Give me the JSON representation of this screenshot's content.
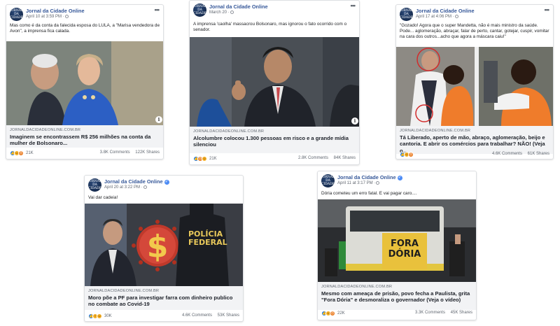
{
  "posts": [
    {
      "page_name": "Jornal da Cidade Online",
      "avatar_text": "JORNAL DA CIDADE",
      "meta": "April 10 at 3:59 PM ·",
      "text": "Mas como é da conta da falecida esposa do LULA, a \"Marisa vendedora de Avon\", a imprensa fica calada.",
      "domain": "JORNALDACIDADEONLINE.COM.BR",
      "headline": "Imaginem se encontrassem R$ 256 milhões na conta da mulher de Bolsonaro...",
      "reactions": "21K",
      "comments": "3.8K Comments",
      "shares": "122K Shares",
      "reaction_icons": [
        "like-icon",
        "haha-icon",
        "angry-icon"
      ]
    },
    {
      "page_name": "Jornal da Cidade Online",
      "avatar_text": "JORNAL DA CIDADE",
      "meta": "March 20 ·",
      "text": "A imprensa 'caolha' massacrou Bolsonaro, mas ignorou o fato ocorrido com o senador.",
      "domain": "JORNALDACIDADEONLINE.COM.BR",
      "headline": "Alcolumbre colocou 1.300 pessoas em risco e a grande mídia silenciou",
      "reactions": "21K",
      "comments": "2.8K Comments",
      "shares": "84K Shares",
      "reaction_icons": [
        "like-icon",
        "angry-icon",
        "haha-icon"
      ]
    },
    {
      "page_name": "Jornal da Cidade Online",
      "avatar_text": "JORNAL DA CIDADE",
      "meta": "April 17 at 4:06 PM ·",
      "text": "\"Gozado! Agora que o super Mandetta, não é mais ministro da saúde. Pode... aglomeração, abraçar, falar de perto, cantar, gotejar, cuspir, vomitar na cara dos outros...acho que agora a máscara caiu!\"",
      "domain": "JORNALDACIDADEONLINE.COM.BR",
      "headline": "Tá Liberado, aperto de mão, abraço, aglomeração, beijo e cantoria. E abrir os comércios para trabalhar? NÃO! (Veja o...",
      "reactions": "",
      "comments": "4.6K Comments",
      "shares": "61K Shares",
      "reaction_icons": [
        "like-icon",
        "haha-icon",
        "angry-icon"
      ]
    },
    {
      "page_name": "Jornal da Cidade Online",
      "avatar_text": "JORNAL DA CIDADE",
      "meta": "April 20 at 3:22 PM ·",
      "text": "Vai dar cadeia!",
      "domain": "JORNALDACIDADEONLINE.COM.BR",
      "headline": "Moro põe a PF para investigar farra com dinheiro publico no combate ao Covid-19",
      "reactions": "30K",
      "comments": "4.6K Comments",
      "shares": "53K Shares",
      "reaction_icons": [
        "like-icon",
        "wow-icon",
        "haha-icon"
      ],
      "image_text": [
        "POLÍCIA",
        "FEDERAL"
      ]
    },
    {
      "page_name": "Jornal da Cidade Online",
      "avatar_text": "JORNAL DA CIDADE",
      "meta": "April 11 at 3:17 PM ·",
      "text": "Dória cometeu um erro fatal. E vai pagar caro....",
      "domain": "JORNALDACIDADEONLINE.COM.BR",
      "headline": "Mesmo com ameaça de prisão, povo fecha a Paulista, grita \"Fora Dória\" e desmoraliza o governador (Veja o vídeo)",
      "reactions": "22K",
      "comments": "3.3K Comments",
      "shares": "45K Shares",
      "reaction_icons": [
        "like-icon",
        "haha-icon",
        "angry-icon"
      ],
      "image_text": [
        "FORA",
        "DÓRIA"
      ]
    }
  ]
}
